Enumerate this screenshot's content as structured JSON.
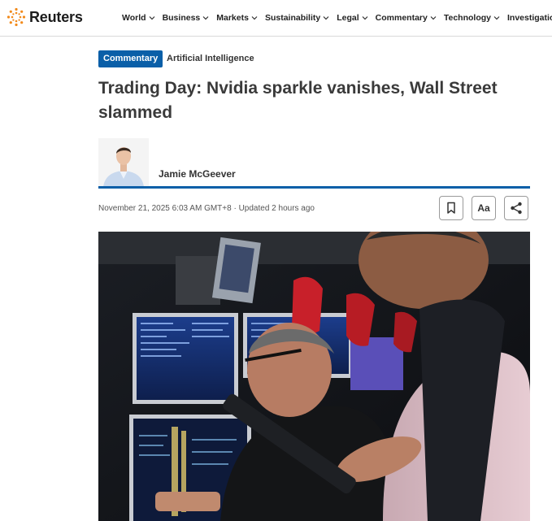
{
  "brand": {
    "name": "Reuters",
    "accent": "#f28a1b",
    "logo_icon": "reuters-dot-sunburst-icon"
  },
  "nav": {
    "items": [
      {
        "label": "World"
      },
      {
        "label": "Business"
      },
      {
        "label": "Markets"
      },
      {
        "label": "Sustainability"
      },
      {
        "label": "Legal"
      },
      {
        "label": "Commentary"
      },
      {
        "label": "Technology"
      },
      {
        "label": "Investigations"
      }
    ]
  },
  "article": {
    "badge": "Commentary",
    "kicker": "Artificial Intelligence",
    "headline": "Trading Day: Nvidia sparkle vanishes, Wall Street slammed",
    "author": "Jamie McGeever",
    "dateline": "November 21, 2025 6:03 AM GMT+8 · Updated 2 hours ago",
    "text_size_label": "Aa",
    "accent": "#0a5fa8"
  },
  "tools": {
    "bookmark_icon": "bookmark-icon",
    "share_icon": "share-icon"
  }
}
